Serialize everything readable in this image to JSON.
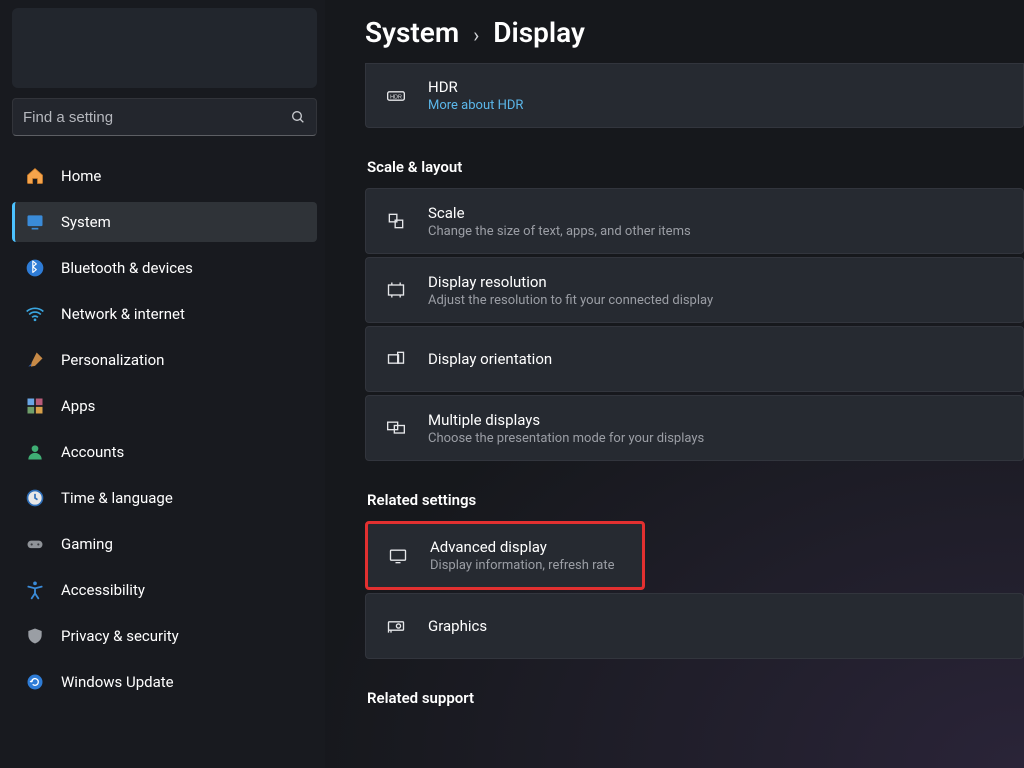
{
  "breadcrumb": {
    "parent": "System",
    "current": "Display"
  },
  "search": {
    "placeholder": "Find a setting"
  },
  "sidebar": {
    "items": [
      {
        "label": "Home",
        "icon": "home-icon",
        "active": false
      },
      {
        "label": "System",
        "icon": "system-icon",
        "active": true
      },
      {
        "label": "Bluetooth & devices",
        "icon": "bluetooth-icon",
        "active": false
      },
      {
        "label": "Network & internet",
        "icon": "wifi-icon",
        "active": false
      },
      {
        "label": "Personalization",
        "icon": "brush-icon",
        "active": false
      },
      {
        "label": "Apps",
        "icon": "apps-icon",
        "active": false
      },
      {
        "label": "Accounts",
        "icon": "person-icon",
        "active": false
      },
      {
        "label": "Time & language",
        "icon": "clock-icon",
        "active": false
      },
      {
        "label": "Gaming",
        "icon": "gamepad-icon",
        "active": false
      },
      {
        "label": "Accessibility",
        "icon": "accessibility-icon",
        "active": false
      },
      {
        "label": "Privacy & security",
        "icon": "shield-icon",
        "active": false
      },
      {
        "label": "Windows Update",
        "icon": "update-icon",
        "active": false
      }
    ]
  },
  "main": {
    "hdr": {
      "title": "HDR",
      "link": "More about HDR"
    },
    "sections": [
      {
        "label": "Scale & layout",
        "items": [
          {
            "title": "Scale",
            "sub": "Change the size of text, apps, and other items",
            "icon": "scale-icon"
          },
          {
            "title": "Display resolution",
            "sub": "Adjust the resolution to fit your connected display",
            "icon": "resolution-icon"
          },
          {
            "title": "Display orientation",
            "sub": "",
            "icon": "orientation-icon"
          },
          {
            "title": "Multiple displays",
            "sub": "Choose the presentation mode for your displays",
            "icon": "multidisplay-icon"
          }
        ]
      },
      {
        "label": "Related settings",
        "items": [
          {
            "title": "Advanced display",
            "sub": "Display information, refresh rate",
            "icon": "monitor-icon",
            "highlight": true
          },
          {
            "title": "Graphics",
            "sub": "",
            "icon": "gpu-icon"
          }
        ]
      },
      {
        "label": "Related support",
        "items": []
      }
    ]
  },
  "colors": {
    "accent": "#4cc2ff",
    "highlight": "#e23030"
  }
}
